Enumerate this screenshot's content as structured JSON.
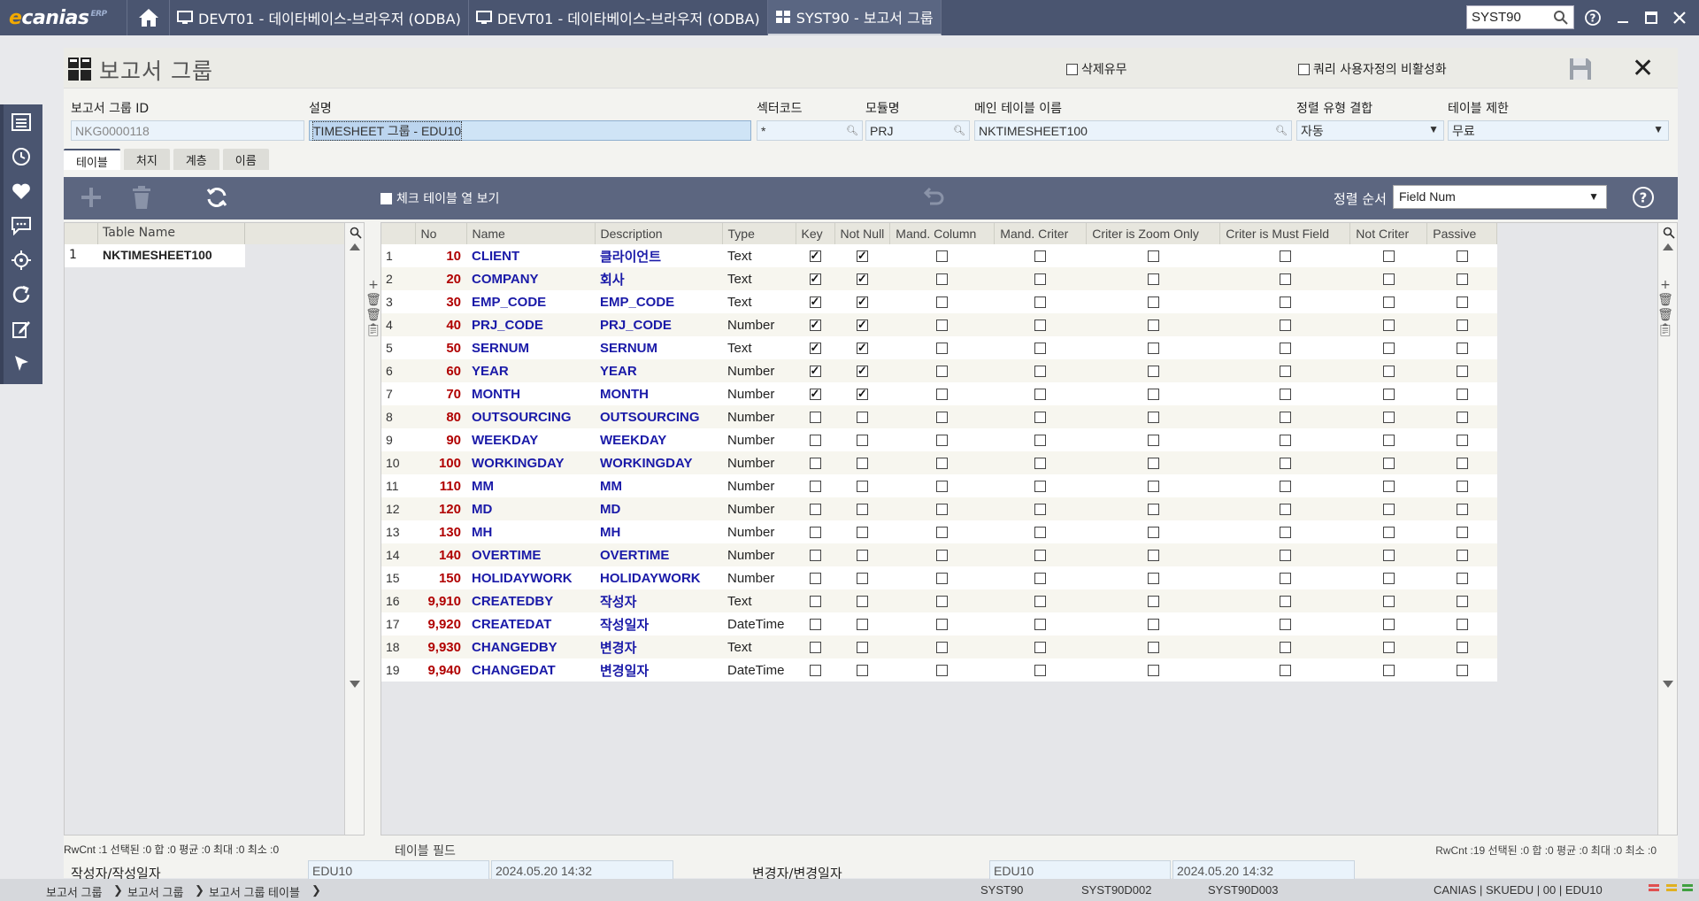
{
  "app": {
    "logo": "canias",
    "logo_sup": "ERP"
  },
  "tabs": [
    {
      "label": "DEVT01 - 데이타베이스-브라우저 (ODBA)"
    },
    {
      "label": "DEVT01 - 데이타베이스-브라우저 (ODBA)"
    },
    {
      "label": "SYST90 - 보고서 그룹"
    }
  ],
  "search": {
    "value": "SYST90"
  },
  "page": {
    "title": "보고서 그룹",
    "flag_delete": "삭제유무",
    "flag_query": "쿼리 사용자정의 비활성화"
  },
  "form": {
    "labels": {
      "id": "보고서 그룹 ID",
      "desc": "설명",
      "sector": "섹터코드",
      "module": "모듈명",
      "maintable": "메인 테이블 이름",
      "sorttype": "정렬 유형 결합",
      "tablelimit": "테이블 제한"
    },
    "values": {
      "id": "NKG0000118",
      "desc": "TIMESHEET 그룹 - EDU10",
      "sector": "*",
      "module": "PRJ",
      "maintable": "NKTIMESHEET100",
      "sorttype": "자동",
      "tablelimit": "무료"
    }
  },
  "subtabs": [
    "테이블",
    "처지",
    "계층",
    "이름"
  ],
  "toolbar": {
    "check_label": "체크 테이블 열 보기",
    "sort_label": "정렬 순서",
    "sort_value": "Field Num"
  },
  "left_grid": {
    "header": "Table Name",
    "rows": [
      {
        "idx": "1",
        "name": "NKTIMESHEET100"
      }
    ],
    "status": "RwCnt :1   선택된 :0   합 :0   평균 :0   최대 :0   최소 :0"
  },
  "right_grid": {
    "headers": [
      "No",
      "Name",
      "Description",
      "Type",
      "Key",
      "Not Null",
      "Mand. Column",
      "Mand. Criter",
      "Criter is Zoom Only",
      "Criter is Must Field",
      "Not Criter",
      "Passive"
    ],
    "rows": [
      {
        "idx": "1",
        "no": "10",
        "name": "CLIENT",
        "desc": "클라이언트",
        "type": "Text",
        "key": true,
        "nn": true
      },
      {
        "idx": "2",
        "no": "20",
        "name": "COMPANY",
        "desc": "회사",
        "type": "Text",
        "key": true,
        "nn": true
      },
      {
        "idx": "3",
        "no": "30",
        "name": "EMP_CODE",
        "desc": "EMP_CODE",
        "type": "Text",
        "key": true,
        "nn": true
      },
      {
        "idx": "4",
        "no": "40",
        "name": "PRJ_CODE",
        "desc": "PRJ_CODE",
        "type": "Number",
        "key": true,
        "nn": true
      },
      {
        "idx": "5",
        "no": "50",
        "name": "SERNUM",
        "desc": "SERNUM",
        "type": "Text",
        "key": true,
        "nn": true
      },
      {
        "idx": "6",
        "no": "60",
        "name": "YEAR",
        "desc": "YEAR",
        "type": "Number",
        "key": true,
        "nn": true
      },
      {
        "idx": "7",
        "no": "70",
        "name": "MONTH",
        "desc": "MONTH",
        "type": "Number",
        "key": true,
        "nn": true
      },
      {
        "idx": "8",
        "no": "80",
        "name": "OUTSOURCING",
        "desc": "OUTSOURCING",
        "type": "Number",
        "key": false,
        "nn": false
      },
      {
        "idx": "9",
        "no": "90",
        "name": "WEEKDAY",
        "desc": "WEEKDAY",
        "type": "Number",
        "key": false,
        "nn": false
      },
      {
        "idx": "10",
        "no": "100",
        "name": "WORKINGDAY",
        "desc": "WORKINGDAY",
        "type": "Number",
        "key": false,
        "nn": false
      },
      {
        "idx": "11",
        "no": "110",
        "name": "MM",
        "desc": "MM",
        "type": "Number",
        "key": false,
        "nn": false
      },
      {
        "idx": "12",
        "no": "120",
        "name": "MD",
        "desc": "MD",
        "type": "Number",
        "key": false,
        "nn": false
      },
      {
        "idx": "13",
        "no": "130",
        "name": "MH",
        "desc": "MH",
        "type": "Number",
        "key": false,
        "nn": false
      },
      {
        "idx": "14",
        "no": "140",
        "name": "OVERTIME",
        "desc": "OVERTIME",
        "type": "Number",
        "key": false,
        "nn": false
      },
      {
        "idx": "15",
        "no": "150",
        "name": "HOLIDAYWORK",
        "desc": "HOLIDAYWORK",
        "type": "Number",
        "key": false,
        "nn": false
      },
      {
        "idx": "16",
        "no": "9,910",
        "name": "CREATEDBY",
        "desc": "작성자",
        "type": "Text",
        "key": false,
        "nn": false
      },
      {
        "idx": "17",
        "no": "9,920",
        "name": "CREATEDAT",
        "desc": "작성일자",
        "type": "DateTime",
        "key": false,
        "nn": false
      },
      {
        "idx": "18",
        "no": "9,930",
        "name": "CHANGEDBY",
        "desc": "변경자",
        "type": "Text",
        "key": false,
        "nn": false
      },
      {
        "idx": "19",
        "no": "9,940",
        "name": "CHANGEDAT",
        "desc": "변경일자",
        "type": "DateTime",
        "key": false,
        "nn": false
      }
    ],
    "status_label": "테이블 필드",
    "status": "RwCnt :19   선택된 :0   합 :0   평균 :0   최대 :0   최소 :0"
  },
  "footer": {
    "created_label": "작성자/작성일자",
    "created_by": "EDU10",
    "created_at": "2024.05.20 14:32",
    "changed_label": "변경자/변경일자",
    "changed_by": "EDU10",
    "changed_at": "2024.05.20 14:32"
  },
  "bottom": {
    "crumbs": [
      "보고서 그룹",
      "보고서 그룹",
      "보고서 그룹 테이블"
    ],
    "codes": [
      "SYST90",
      "SYST90D002",
      "SYST90D003"
    ],
    "session": "CANIAS | SKUEDU | 00 | EDU10"
  },
  "colors": {
    "topbar": "#4a5570",
    "toolbar": "#5c6680",
    "field_bg": "#eaf3fb",
    "number_red": "#b00000",
    "name_blue": "#1a1aa8"
  }
}
